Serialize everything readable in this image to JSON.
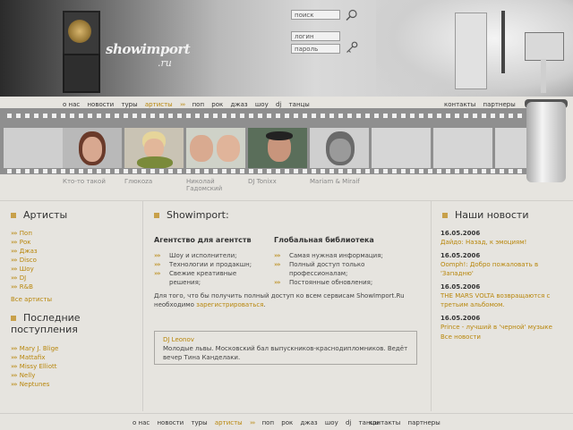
{
  "header": {
    "logo": "showimport",
    "logo_sub": ".ru",
    "search_placeholder": "поиск",
    "login_placeholder": "логин",
    "password_placeholder": "пароль"
  },
  "nav": {
    "items": [
      "о нас",
      "новости",
      "туры",
      "артисты"
    ],
    "genres": [
      "поп",
      "рок",
      "джаз",
      "шоу",
      "dj",
      "танцы"
    ],
    "right": [
      "контакты",
      "партнеры"
    ]
  },
  "artists_strip": [
    {
      "name": "Кто-то такой"
    },
    {
      "name": "Глюкоzа"
    },
    {
      "name": "Николай Гадомский"
    },
    {
      "name": "DJ Tonixx"
    },
    {
      "name": "Mariam & Miraif"
    }
  ],
  "left": {
    "artists_title": "Артисты",
    "artists": [
      "Поп",
      "Рок",
      "Джаз",
      "Disco",
      "Шоу",
      "DJ",
      "R&B"
    ],
    "all_artists": "Все артисты",
    "latest_title": "Последние поступления",
    "latest": [
      "Mary J. Blige",
      "Mattafix",
      "Missy Elliott",
      "Nelly",
      "Neptunes"
    ]
  },
  "main": {
    "title": "Showimport:",
    "agency_title": "Агентство для агентств",
    "agency_items": [
      "Шоу и исполнители;",
      "Технологии и продакшн;",
      "Свежие креативные решения;"
    ],
    "library_title": "Глобальная библиотека",
    "library_items": [
      "Самая нужная информация;",
      "Полный доступ только профессионалам;",
      "Постоянные обновления;"
    ],
    "info_text": "Для того, что бы получить полный доступ ко всем сервисам ShowImport.Ru необходимо",
    "info_link": "зарегистрироваться",
    "info_end": ".",
    "quote_author": "DJ Leonov",
    "quote_text": "Молодые львы. Московский бал выпускников-краснодипломников. Ведёт вечер Тина Канделаки."
  },
  "news": {
    "title": "Наши новости",
    "items": [
      {
        "date": "16.05.2006",
        "text": "Дайдо: Назад, к эмоциям!"
      },
      {
        "date": "16.05.2006",
        "text": "Oomph!: Добро пожаловать в 'Западню'"
      },
      {
        "date": "16.05.2006",
        "text": "THE MARS VOLTA возвращаются с третьим альбомом."
      },
      {
        "date": "16.05.2006",
        "text": "Prince - лучший в 'черной' музыке"
      }
    ],
    "all_news": "Все новости"
  },
  "colors": {
    "accent": "#b8860b",
    "background": "#e6e4df"
  }
}
